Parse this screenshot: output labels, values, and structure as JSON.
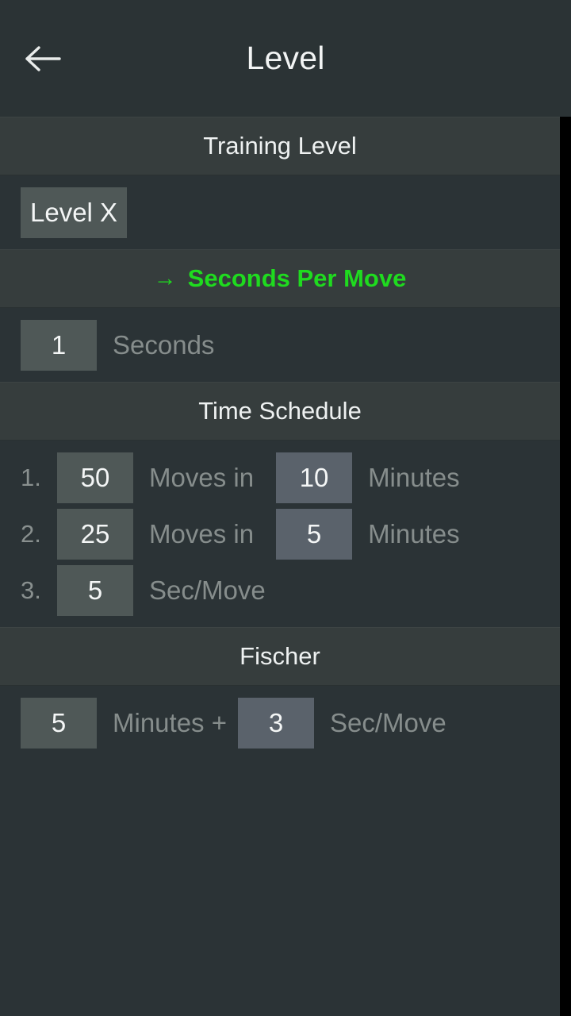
{
  "appbar": {
    "title": "Level",
    "back_icon": "arrow-left-icon"
  },
  "scroll": {
    "visible": true
  },
  "sections": [
    {
      "id": "training-level",
      "title": "Training Level",
      "active": false,
      "rows": [
        {
          "chip": "Level X",
          "label": ""
        }
      ]
    },
    {
      "id": "seconds-per-move",
      "title": "Seconds Per Move",
      "active": true,
      "arrow": "→",
      "rows": [
        {
          "chip": "1",
          "label": "Seconds"
        }
      ]
    },
    {
      "id": "time-schedule",
      "title": "Time Schedule",
      "active": false,
      "rows": [
        {
          "index": "1.",
          "moves": "50",
          "moves_label": "Moves in",
          "minutes": "10",
          "minutes_label": "Minutes"
        },
        {
          "index": "2.",
          "moves": "25",
          "moves_label": "Moves in",
          "minutes": "5",
          "minutes_label": "Minutes"
        },
        {
          "index": "3.",
          "moves": "5",
          "moves_label": "Sec/Move"
        }
      ]
    },
    {
      "id": "fischer",
      "title": "Fischer",
      "active": false,
      "rows": [
        {
          "minutes": "5",
          "minutes_label": "Minutes +",
          "increment": "3",
          "increment_label": "Sec/Move"
        }
      ]
    }
  ],
  "colors": {
    "accent_green": "#1fdb1f",
    "page_bg": "#2b3336",
    "section_header_bg": "#363d3d",
    "chip_green": "#4f5857",
    "chip_blue": "#5a626b",
    "label_gray": "#868d8c",
    "title_white": "#eef1f1"
  }
}
